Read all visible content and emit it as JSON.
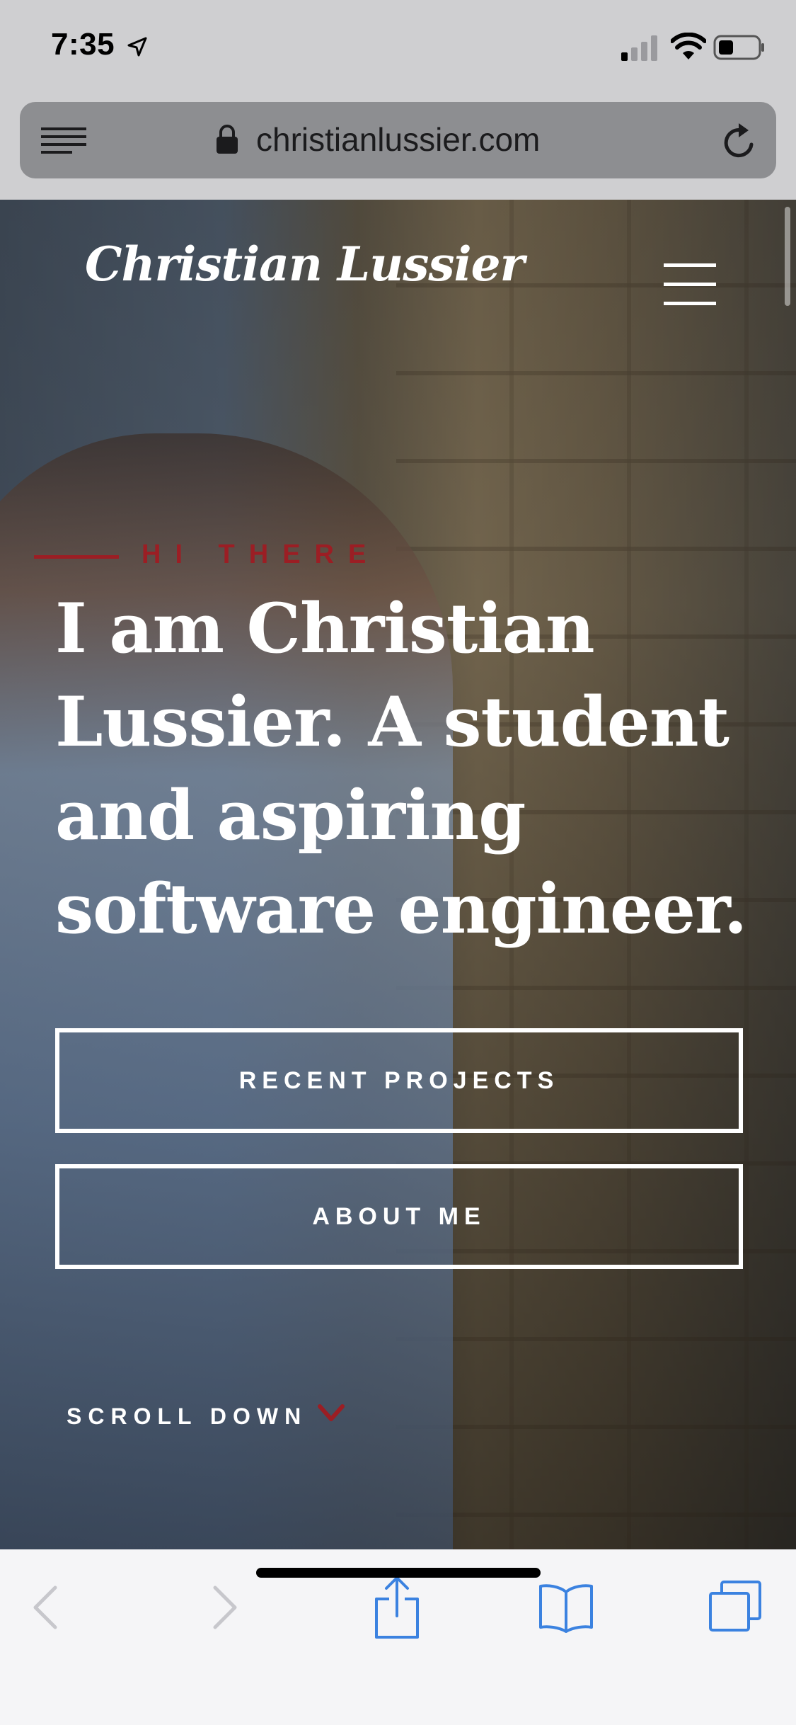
{
  "status_bar": {
    "time": "7:35"
  },
  "address_bar": {
    "url": "christianlussier.com"
  },
  "site": {
    "logo": "Christian Lussier",
    "eyebrow": "HI THERE",
    "headline_lines": [
      "I am Christian",
      "Lussier. A student",
      "and aspiring",
      "software engineer."
    ],
    "buttons": {
      "recent_projects": "RECENT PROJECTS",
      "about_me": "ABOUT ME"
    },
    "scroll_down": "SCROLL DOWN"
  },
  "colors": {
    "accent": "#9b1e24",
    "ios_blue": "#3b82e0",
    "disabled_icon": "#c7c7cc"
  },
  "icons": [
    "location-arrow-icon",
    "cellular-signal-icon",
    "wifi-icon",
    "battery-icon",
    "reader-view-icon",
    "lock-icon",
    "reload-icon",
    "hamburger-menu-icon",
    "chevron-down-icon",
    "back-icon",
    "forward-icon",
    "share-icon",
    "bookmarks-icon",
    "tabs-icon"
  ]
}
